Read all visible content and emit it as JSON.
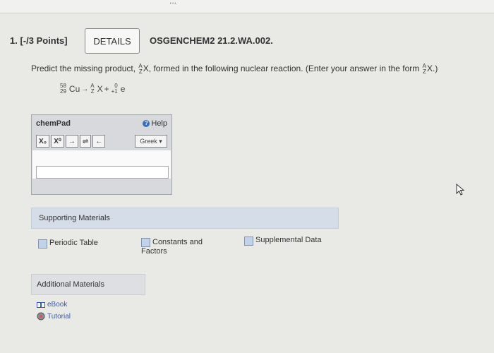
{
  "top": {
    "cut_text": "..."
  },
  "question": {
    "number": "1. [-/3 Points]",
    "details_label": "DETAILS",
    "code": "OSGENCHEM2 21.2.WA.002."
  },
  "prompt": {
    "part1": "Predict the missing product,",
    "part2": "X, formed in the following nuclear reaction. (Enter your answer in the form",
    "part3": "X.)",
    "iso_top": "A",
    "iso_bottom": "Z"
  },
  "reaction": {
    "reactant_mass": "58",
    "reactant_number": "29",
    "reactant_symbol": "Cu",
    "arrow": "→",
    "product_mass": "A",
    "product_number": "Z",
    "product_symbol": "X",
    "plus": "+",
    "emitted_mass": "0",
    "emitted_number": "+1",
    "emitted_symbol": "e"
  },
  "chempad": {
    "title": "chemPad",
    "help": "Help",
    "help_icon": "?",
    "subscript_btn": "X₀",
    "superscript_btn": "X⁰",
    "arrow_btn": "→",
    "equilibrium_btn": "⇌",
    "back_btn": "←",
    "greek_label": "Greek ▾",
    "input_value": ""
  },
  "supporting": {
    "title": "Supporting Materials",
    "items": [
      "Periodic Table",
      "Constants and Factors",
      "Supplemental Data"
    ]
  },
  "additional": {
    "title": "Additional Materials",
    "links": [
      "eBook",
      "Tutorial"
    ]
  }
}
